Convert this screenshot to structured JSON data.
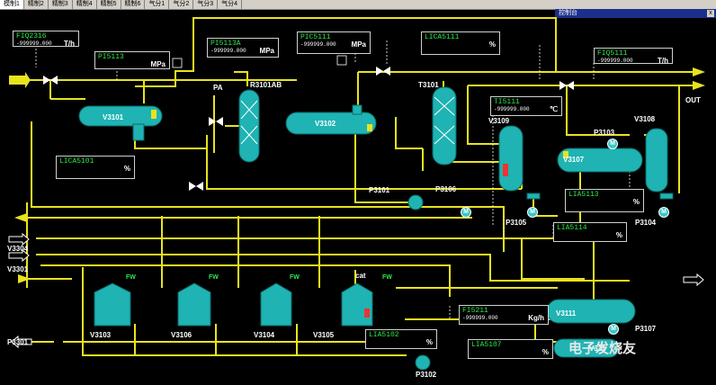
{
  "tabs": [
    "模制1",
    "精制2",
    "精制3",
    "精制4",
    "精制5",
    "精制6",
    "气分1",
    "气分2",
    "气分3",
    "气分4"
  ],
  "control_title": "控制台",
  "close_glyph": "x",
  "colors": {
    "pipe": "#e8e31f",
    "vessel": "#1fb3b3",
    "tag_name": "#2ee84a",
    "background": "#000000"
  },
  "tags": [
    {
      "id": "FIQ2316",
      "name": "FIQ2316",
      "value": "-999999.000",
      "unit": "T/h"
    },
    {
      "id": "PI5113",
      "name": "PI5113",
      "value": "",
      "unit": "MPa"
    },
    {
      "id": "PI5113A",
      "name": "PI5113A",
      "value": "-999999.000",
      "unit": "MPa"
    },
    {
      "id": "PIC5111",
      "name": "PIC5111",
      "value": "-999999.000",
      "unit": "MPa"
    },
    {
      "id": "LICA5111",
      "name": "LICA5111",
      "value": "",
      "unit": "%"
    },
    {
      "id": "FIQ5111",
      "name": "FIQ5111",
      "value": "-999999.000",
      "unit": "T/h"
    },
    {
      "id": "TI5111",
      "name": "TI5111",
      "value": "-999999.000",
      "unit": "℃"
    },
    {
      "id": "LICA5101",
      "name": "LICA5101",
      "value": "",
      "unit": "%"
    },
    {
      "id": "LIA5113",
      "name": "LIA5113",
      "value": "",
      "unit": "%"
    },
    {
      "id": "LIA5114",
      "name": "LIA5114",
      "value": "",
      "unit": "%"
    },
    {
      "id": "FI5211",
      "name": "FI5211",
      "value": "-999999.000",
      "unit": "Kg/h"
    },
    {
      "id": "LIA5102",
      "name": "LIA5102",
      "value": "",
      "unit": "%"
    },
    {
      "id": "LIA5107",
      "name": "LIA5107",
      "value": "",
      "unit": "%"
    }
  ],
  "labels": {
    "V3101": "V3101",
    "R3101AB": "R3101AB",
    "PA": "PA",
    "V3102": "V3102",
    "T3101": "T3101",
    "V3109": "V3109",
    "P3103": "P3103",
    "V3108": "V3108",
    "OUT": "OUT",
    "V3107": "V3107",
    "P3101": "P3101",
    "P3106": "P3106",
    "P3105": "P3105",
    "P3104": "P3104",
    "V3304": "V3304",
    "V3301": "V3301",
    "V3103": "V3103",
    "V3106": "V3106",
    "V3104": "V3104",
    "V3105": "V3105",
    "cat": "cat",
    "V3111": "V3111",
    "P3107": "P3107",
    "V3112": "V311",
    "P3301": "P3301",
    "P3102": "P3102"
  },
  "fw_label": "FW",
  "motor_label": "M",
  "watermark": "电子发烧友"
}
